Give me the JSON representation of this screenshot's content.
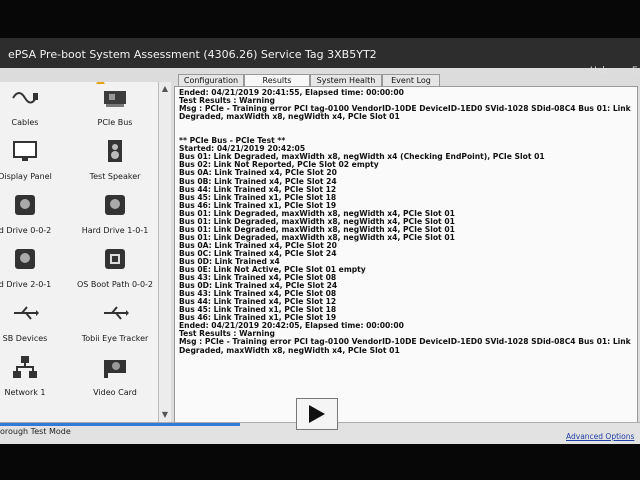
{
  "window": {
    "title": "ePSA Pre-boot System Assessment (4306.26)   Service Tag 3XB5YT2",
    "help_label": "Help",
    "exit_label": "E"
  },
  "sidebar": {
    "devices": [
      {
        "label": "Cables",
        "icon": "cable-icon"
      },
      {
        "label": "PCIe Bus",
        "icon": "pcie-card-icon",
        "warning": true
      },
      {
        "label": "Display Panel",
        "icon": "monitor-icon"
      },
      {
        "label": "Test Speaker",
        "icon": "speaker-icon"
      },
      {
        "label": "d Drive 0-0-2",
        "icon": "hard-drive-icon"
      },
      {
        "label": "Hard Drive 1-0-1",
        "icon": "hard-drive-icon"
      },
      {
        "label": "d Drive 2-0-1",
        "icon": "hard-drive-icon"
      },
      {
        "label": "OS Boot Path 0-0-2",
        "icon": "boot-path-icon"
      },
      {
        "label": "SB Devices",
        "icon": "usb-icon"
      },
      {
        "label": "Tobii Eye Tracker",
        "icon": "usb-icon"
      },
      {
        "label": "Network 1",
        "icon": "network-icon"
      },
      {
        "label": "Video Card",
        "icon": "video-card-icon"
      }
    ]
  },
  "tabs": [
    {
      "label": "Configuration",
      "active": false
    },
    {
      "label": "Results",
      "active": true
    },
    {
      "label": "System Health",
      "active": false
    },
    {
      "label": "Event Log",
      "active": false
    }
  ],
  "log_lines": [
    "Ended: 04/21/2019 20:41:55, Elapsed time: 00:00:00",
    "Test Results : Warning",
    "Msg : PCIe - Training error PCI tag-0100 VendorID-10DE DeviceID-1ED0 SVid-1028 SDid-08C4 Bus 01: Link",
    "Degraded, maxWidth x8, negWidth x4, PCIe Slot 01",
    "",
    "",
    "** PCIe Bus - PCIe Test **",
    "Started: 04/21/2019 20:42:05",
    "Bus 01: Link Degraded, maxWidth x8, negWidth x4 (Checking EndPoint), PCIe Slot 01",
    "Bus 02: Link Not Reported, PCIe Slot 02 empty",
    "Bus 0A: Link Trained x4, PCIe Slot 20",
    "Bus 0B: Link Trained x4, PCIe Slot 24",
    "Bus 44: Link Trained x4, PCIe Slot 12",
    "Bus 45: Link Trained x1, PCIe Slot 18",
    "Bus 46: Link Trained x1, PCIe Slot 19",
    "Bus 01: Link Degraded, maxWidth x8, negWidth x4, PCIe Slot 01",
    "Bus 01: Link Degraded, maxWidth x8, negWidth x4, PCIe Slot 01",
    "Bus 01: Link Degraded, maxWidth x8, negWidth x4, PCIe Slot 01",
    "Bus 01: Link Degraded, maxWidth x8, negWidth x4, PCIe Slot 01",
    "Bus 0A: Link Trained x4, PCIe Slot 20",
    "Bus 0C: Link Trained x4, PCIe Slot 24",
    "Bus 0D: Link Trained x4",
    "Bus 0E: Link Not Active, PCIe Slot 01 empty",
    "Bus 43: Link Trained x4, PCIe Slot 08",
    "Bus 0D: Link Trained x4, PCIe Slot 24",
    "Bus 43: Link Trained x4, PCIe Slot 08",
    "Bus 44: Link Trained x4, PCIe Slot 12",
    "Bus 45: Link Trained x1, PCIe Slot 18",
    "Bus 46: Link Trained x1, PCIe Slot 19",
    "Ended: 04/21/2019 20:42:05, Elapsed time: 00:00:00",
    "Test Results : Warning",
    "Msg : PCIe - Training error PCI tag-0100 VendorID-10DE DeviceID-1ED0 SVid-1028 SDid-08C4 Bus 01: Link",
    "Degraded, maxWidth x8, negWidth x4, PCIe Slot 01"
  ],
  "footer": {
    "mode_label": "orough Test Mode",
    "advanced_label": "Advanced Options"
  },
  "colors": {
    "titlebar": "#2d2d2d",
    "accent_link": "#1e3fa8",
    "warning": "#e8a317",
    "progress": "#2f7bd6"
  }
}
